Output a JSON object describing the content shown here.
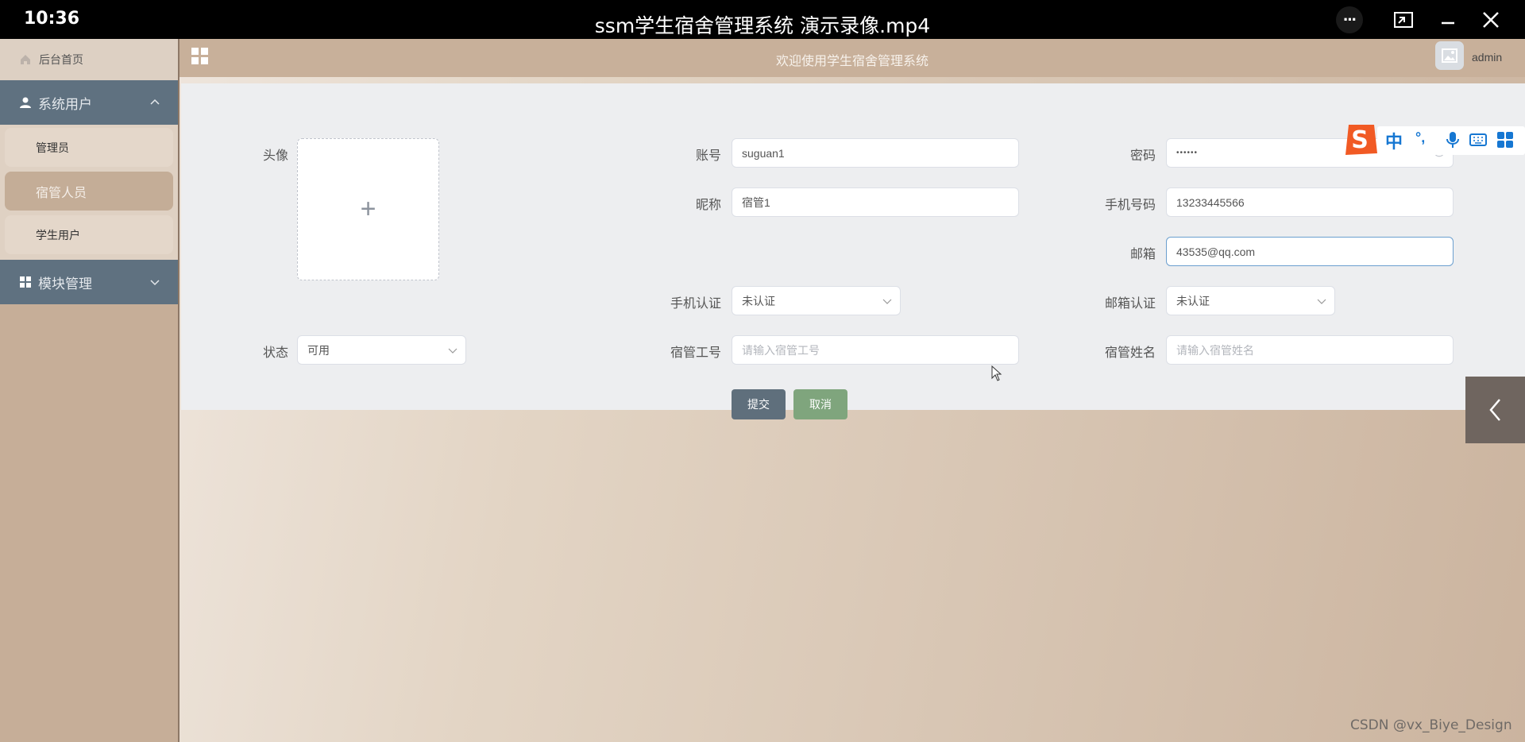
{
  "player": {
    "time": "10:36",
    "title": "ssm学生宿舍管理系统 演示录像.mp4",
    "more_label": "···"
  },
  "sidebar": {
    "home_label": "后台首页",
    "groups": [
      {
        "label": "系统用户",
        "expanded": true,
        "icon": "user-icon",
        "items": [
          {
            "label": "管理员"
          },
          {
            "label": "宿管人员",
            "active": true
          },
          {
            "label": "学生用户"
          }
        ]
      },
      {
        "label": "模块管理",
        "expanded": false,
        "icon": "grid-icon"
      }
    ]
  },
  "header": {
    "title": "欢迎使用学生宿舍管理系统",
    "username": "admin"
  },
  "form": {
    "avatar_label": "头像",
    "upload_symbol": "+",
    "account": {
      "label": "账号",
      "value": "suguan1"
    },
    "password": {
      "label": "密码",
      "value": "••••••"
    },
    "nickname": {
      "label": "昵称",
      "value": "宿管1"
    },
    "phone": {
      "label": "手机号码",
      "value": "13233445566"
    },
    "email": {
      "label": "邮箱",
      "value": "43535@qq.com"
    },
    "phone_verify": {
      "label": "手机认证",
      "value": "未认证"
    },
    "email_verify": {
      "label": "邮箱认证",
      "value": "未认证"
    },
    "status": {
      "label": "状态",
      "value": "可用"
    },
    "staff_no": {
      "label": "宿管工号",
      "placeholder": "请输入宿管工号"
    },
    "staff_name": {
      "label": "宿管姓名",
      "placeholder": "请输入宿管姓名"
    },
    "submit_label": "提交",
    "cancel_label": "取消"
  },
  "ime": {
    "mode": "中",
    "punct": "°,"
  },
  "watermark": "CSDN @vx_Biye_Design",
  "colors": {
    "sidebar_group": "#5f7180",
    "submit": "#5f6f7c",
    "cancel": "#7fa57d",
    "focus_border": "#6b9fcf"
  }
}
